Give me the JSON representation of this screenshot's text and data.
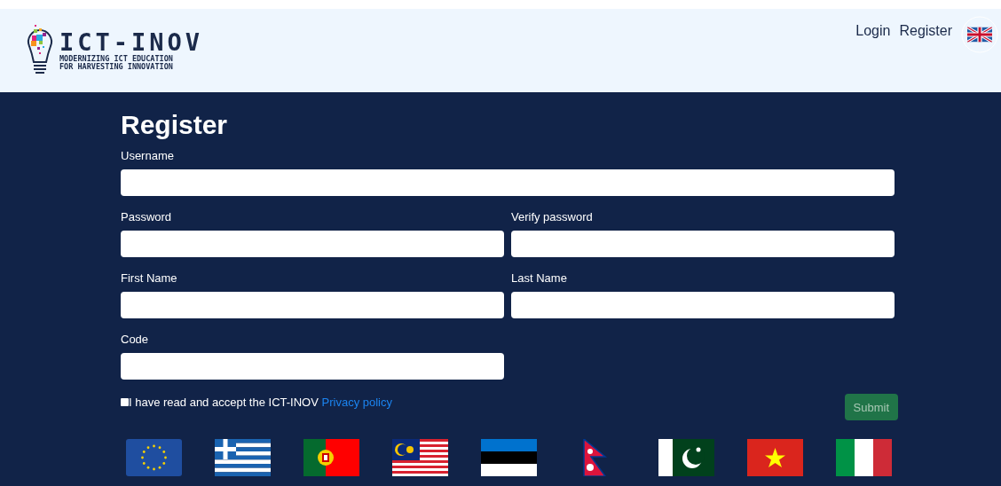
{
  "header": {
    "logo": {
      "title": "ICT-INOV",
      "subtitle_lines": [
        "MODERNIZING ICT EDUCATION",
        "FOR HARVESTING INNOVATION"
      ]
    },
    "nav": [
      "Login",
      "Register"
    ]
  },
  "form": {
    "title": "Register",
    "rows": [
      [
        {
          "label": "Username"
        }
      ],
      [
        {
          "label": "Password"
        },
        {
          "label": "Verify password"
        }
      ],
      [
        {
          "label": "First Name"
        },
        {
          "label": "Last Name"
        }
      ],
      [
        {
          "label": "Code"
        }
      ]
    ],
    "consent": {
      "checked": false,
      "text": "I have read and accept the ICT-INOV",
      "link": "Privacy policy"
    },
    "submit": {
      "label": "Submit",
      "disabled": true
    }
  }
}
